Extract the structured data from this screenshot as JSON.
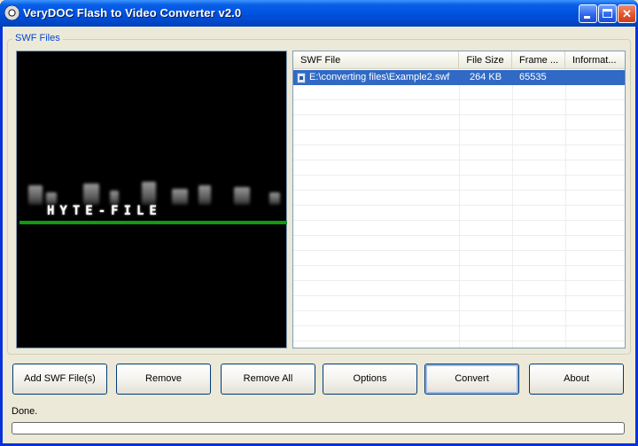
{
  "window": {
    "title": "VeryDOC Flash to Video Converter v2.0",
    "icon": "film-reel-icon"
  },
  "group": {
    "label": "SWF Files"
  },
  "preview": {
    "flash_text": "HYTE-FILE"
  },
  "file_list": {
    "columns": [
      "SWF File",
      "File Size",
      "Frame ...",
      "Informat..."
    ],
    "rows": [
      {
        "file": "E:\\converting files\\Example2.swf",
        "size": "264 KB",
        "frames": "65535",
        "info": "",
        "selected": true
      }
    ]
  },
  "buttons": {
    "add": "Add SWF File(s)",
    "remove": "Remove",
    "remove_all": "Remove All",
    "options": "Options",
    "convert": "Convert",
    "about": "About"
  },
  "status": {
    "text": "Done.",
    "progress": 0
  },
  "colors": {
    "titlebar": "#0054e3",
    "selection": "#316ac5",
    "group_label": "#0046d5",
    "preview_line": "#0f9a12"
  }
}
